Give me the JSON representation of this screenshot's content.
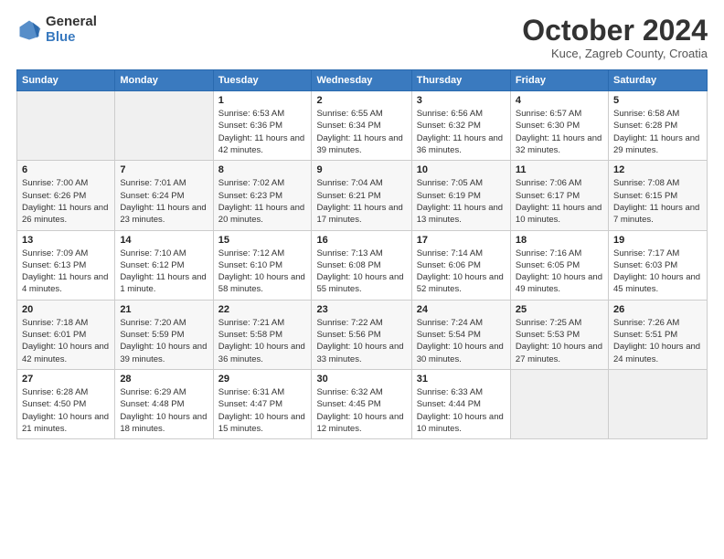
{
  "logo": {
    "general": "General",
    "blue": "Blue"
  },
  "title": "October 2024",
  "location": "Kuce, Zagreb County, Croatia",
  "days_header": [
    "Sunday",
    "Monday",
    "Tuesday",
    "Wednesday",
    "Thursday",
    "Friday",
    "Saturday"
  ],
  "weeks": [
    [
      {
        "num": "",
        "info": ""
      },
      {
        "num": "",
        "info": ""
      },
      {
        "num": "1",
        "info": "Sunrise: 6:53 AM\nSunset: 6:36 PM\nDaylight: 11 hours and 42 minutes."
      },
      {
        "num": "2",
        "info": "Sunrise: 6:55 AM\nSunset: 6:34 PM\nDaylight: 11 hours and 39 minutes."
      },
      {
        "num": "3",
        "info": "Sunrise: 6:56 AM\nSunset: 6:32 PM\nDaylight: 11 hours and 36 minutes."
      },
      {
        "num": "4",
        "info": "Sunrise: 6:57 AM\nSunset: 6:30 PM\nDaylight: 11 hours and 32 minutes."
      },
      {
        "num": "5",
        "info": "Sunrise: 6:58 AM\nSunset: 6:28 PM\nDaylight: 11 hours and 29 minutes."
      }
    ],
    [
      {
        "num": "6",
        "info": "Sunrise: 7:00 AM\nSunset: 6:26 PM\nDaylight: 11 hours and 26 minutes."
      },
      {
        "num": "7",
        "info": "Sunrise: 7:01 AM\nSunset: 6:24 PM\nDaylight: 11 hours and 23 minutes."
      },
      {
        "num": "8",
        "info": "Sunrise: 7:02 AM\nSunset: 6:23 PM\nDaylight: 11 hours and 20 minutes."
      },
      {
        "num": "9",
        "info": "Sunrise: 7:04 AM\nSunset: 6:21 PM\nDaylight: 11 hours and 17 minutes."
      },
      {
        "num": "10",
        "info": "Sunrise: 7:05 AM\nSunset: 6:19 PM\nDaylight: 11 hours and 13 minutes."
      },
      {
        "num": "11",
        "info": "Sunrise: 7:06 AM\nSunset: 6:17 PM\nDaylight: 11 hours and 10 minutes."
      },
      {
        "num": "12",
        "info": "Sunrise: 7:08 AM\nSunset: 6:15 PM\nDaylight: 11 hours and 7 minutes."
      }
    ],
    [
      {
        "num": "13",
        "info": "Sunrise: 7:09 AM\nSunset: 6:13 PM\nDaylight: 11 hours and 4 minutes."
      },
      {
        "num": "14",
        "info": "Sunrise: 7:10 AM\nSunset: 6:12 PM\nDaylight: 11 hours and 1 minute."
      },
      {
        "num": "15",
        "info": "Sunrise: 7:12 AM\nSunset: 6:10 PM\nDaylight: 10 hours and 58 minutes."
      },
      {
        "num": "16",
        "info": "Sunrise: 7:13 AM\nSunset: 6:08 PM\nDaylight: 10 hours and 55 minutes."
      },
      {
        "num": "17",
        "info": "Sunrise: 7:14 AM\nSunset: 6:06 PM\nDaylight: 10 hours and 52 minutes."
      },
      {
        "num": "18",
        "info": "Sunrise: 7:16 AM\nSunset: 6:05 PM\nDaylight: 10 hours and 49 minutes."
      },
      {
        "num": "19",
        "info": "Sunrise: 7:17 AM\nSunset: 6:03 PM\nDaylight: 10 hours and 45 minutes."
      }
    ],
    [
      {
        "num": "20",
        "info": "Sunrise: 7:18 AM\nSunset: 6:01 PM\nDaylight: 10 hours and 42 minutes."
      },
      {
        "num": "21",
        "info": "Sunrise: 7:20 AM\nSunset: 5:59 PM\nDaylight: 10 hours and 39 minutes."
      },
      {
        "num": "22",
        "info": "Sunrise: 7:21 AM\nSunset: 5:58 PM\nDaylight: 10 hours and 36 minutes."
      },
      {
        "num": "23",
        "info": "Sunrise: 7:22 AM\nSunset: 5:56 PM\nDaylight: 10 hours and 33 minutes."
      },
      {
        "num": "24",
        "info": "Sunrise: 7:24 AM\nSunset: 5:54 PM\nDaylight: 10 hours and 30 minutes."
      },
      {
        "num": "25",
        "info": "Sunrise: 7:25 AM\nSunset: 5:53 PM\nDaylight: 10 hours and 27 minutes."
      },
      {
        "num": "26",
        "info": "Sunrise: 7:26 AM\nSunset: 5:51 PM\nDaylight: 10 hours and 24 minutes."
      }
    ],
    [
      {
        "num": "27",
        "info": "Sunrise: 6:28 AM\nSunset: 4:50 PM\nDaylight: 10 hours and 21 minutes."
      },
      {
        "num": "28",
        "info": "Sunrise: 6:29 AM\nSunset: 4:48 PM\nDaylight: 10 hours and 18 minutes."
      },
      {
        "num": "29",
        "info": "Sunrise: 6:31 AM\nSunset: 4:47 PM\nDaylight: 10 hours and 15 minutes."
      },
      {
        "num": "30",
        "info": "Sunrise: 6:32 AM\nSunset: 4:45 PM\nDaylight: 10 hours and 12 minutes."
      },
      {
        "num": "31",
        "info": "Sunrise: 6:33 AM\nSunset: 4:44 PM\nDaylight: 10 hours and 10 minutes."
      },
      {
        "num": "",
        "info": ""
      },
      {
        "num": "",
        "info": ""
      }
    ]
  ]
}
